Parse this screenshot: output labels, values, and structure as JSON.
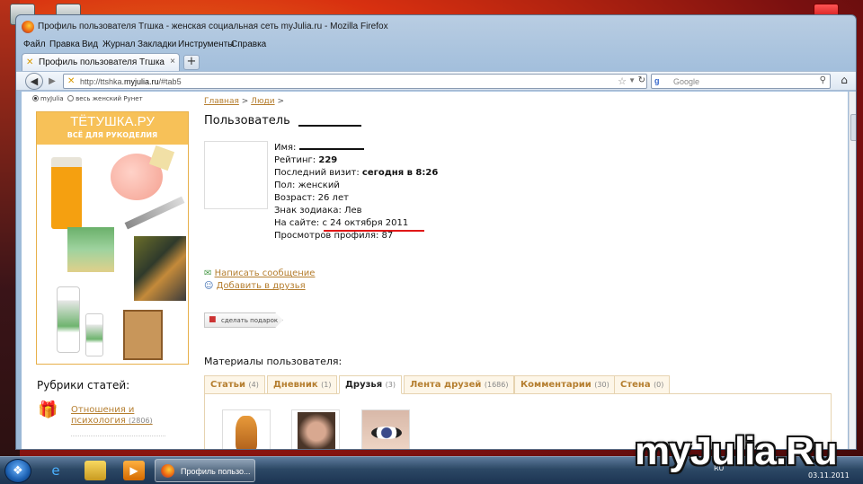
{
  "window": {
    "title": "Профиль пользователя Тгшка - женская социальная сеть myJulia.ru - Mozilla Firefox"
  },
  "menubar": {
    "items": [
      "Файл",
      "Правка",
      "Вид",
      "Журнал",
      "Закладки",
      "Инструменты",
      "Справка"
    ]
  },
  "tab": {
    "label": "Профиль пользователя Тгшка - женск...",
    "close": "×",
    "new_tab": "+"
  },
  "address": {
    "url_prefix": "http://ttshka.",
    "url_domain": "myjulia.ru",
    "url_suffix": "/#tab5"
  },
  "search": {
    "engine": "g",
    "placeholder": "Google"
  },
  "page": {
    "search_scope": {
      "option1": "myJulia",
      "option2": "весь женский Рунет",
      "selected": "myJulia"
    },
    "ad": {
      "title": "ТЁТУШКА.РУ",
      "subtitle": "ВСЁ ДЛЯ РУКОДЕЛИЯ"
    },
    "rubrics": {
      "title": "Рубрики статей:",
      "first_item": "Отношения и психология",
      "first_count": "(2806)"
    },
    "breadcrumb": {
      "home": "Главная",
      "people": "Люди",
      "sep": ">"
    },
    "profile": {
      "title": "Пользователь",
      "name_label": "Имя:",
      "rating_label": "Рейтинг:",
      "rating": "229",
      "last_visit_label": "Последний визит:",
      "last_visit": "сегодня в 8:26",
      "gender": "Пол: женский",
      "age": "Возраст: 26 лет",
      "zodiac": "Знак зодиака: Лев",
      "on_site_label": "На сайте:",
      "on_site": "с 24 октября 2011",
      "views": "Просмотров профиля: 87"
    },
    "actions": {
      "message": "Написать сообщение",
      "add_friend": "Добавить в друзья",
      "gift": "сделать подарок"
    },
    "materials": {
      "title": "Материалы пользователя:",
      "tabs": [
        {
          "label": "Статьи",
          "count": "(4)"
        },
        {
          "label": "Дневник",
          "count": "(1)"
        },
        {
          "label": "Друзья",
          "count": "(3)"
        },
        {
          "label": "Лента друзей",
          "count": "(1686)"
        },
        {
          "label": "Комментарии",
          "count": "(30)"
        },
        {
          "label": "Стена",
          "count": "(0)"
        }
      ],
      "active_tab": "Друзья"
    }
  },
  "taskbar": {
    "task_label": "Профиль пользо...",
    "language": "RU",
    "date": "03.11.2011"
  },
  "watermark": "myJulia.Ru",
  "colors": {
    "link": "#b57e2f",
    "accent_red": "#e01818",
    "ad_orange": "#f7c158"
  }
}
